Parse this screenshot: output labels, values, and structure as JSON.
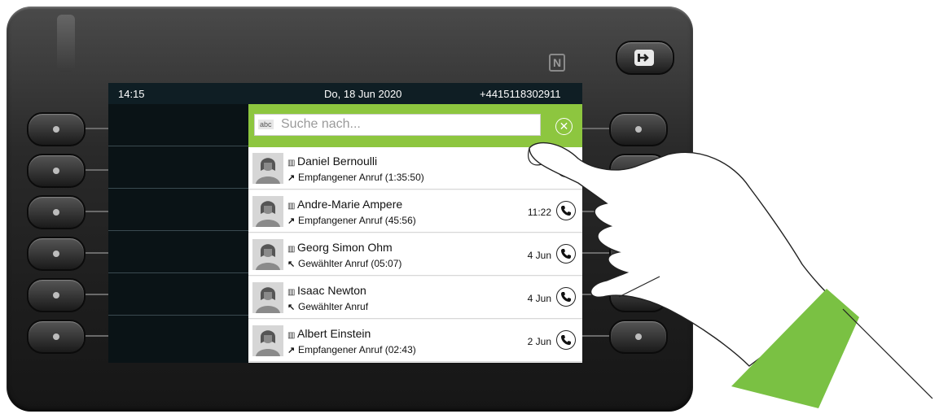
{
  "status_bar": {
    "time": "14:15",
    "date": "Do, 18 Jun 2020",
    "number": "+4415118302911"
  },
  "search": {
    "abc_label": "abc",
    "placeholder": "Suche nach..."
  },
  "calls": [
    {
      "name": "Daniel Bernoulli",
      "direction": "incoming",
      "detail": "Empfangener Anruf (1:35:50)",
      "time": ""
    },
    {
      "name": "Andre-Marie Ampere",
      "direction": "incoming",
      "detail": "Empfangener Anruf (45:56)",
      "time": "11:22"
    },
    {
      "name": "Georg Simon Ohm",
      "direction": "outgoing",
      "detail": "Gewählter Anruf (05:07)",
      "time": "4 Jun"
    },
    {
      "name": "Isaac Newton",
      "direction": "outgoing",
      "detail": "Gewählter Anruf",
      "time": "4 Jun"
    },
    {
      "name": "Albert Einstein",
      "direction": "incoming",
      "detail": "Empfangener Anruf (02:43)",
      "time": "2 Jun"
    }
  ],
  "colors": {
    "accent_green": "#8dc63f",
    "screen_bg": "#0c1518",
    "sleeve_green": "#7ac143"
  }
}
